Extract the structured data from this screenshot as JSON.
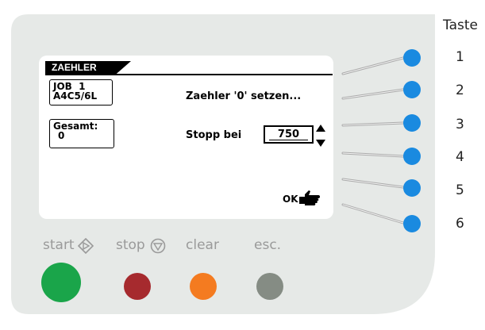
{
  "side_label": "Taste",
  "display": {
    "title": "ZAEHLER",
    "job_box": {
      "line1": "JOB  1",
      "line2": "A4C5/6L"
    },
    "total_box": {
      "label": "Gesamt:",
      "value": "0"
    },
    "reset_text": "Zaehler '0' setzen...",
    "stop_label": "Stopp bei",
    "stop_value": "750",
    "ok_label": "OK"
  },
  "softkeys": [
    {
      "number": "1"
    },
    {
      "number": "2"
    },
    {
      "number": "3"
    },
    {
      "number": "4"
    },
    {
      "number": "5"
    },
    {
      "number": "6"
    }
  ],
  "controls": {
    "start_label": "start",
    "stop_label": "stop",
    "clear_label": "clear",
    "esc_label": "esc."
  },
  "colors": {
    "panel": "#e6e9e7",
    "softkey": "#1a8ae0",
    "start": "#1aa54a",
    "stop": "#a62a2e",
    "clear": "#f47b20",
    "esc": "#858c84"
  },
  "icons": {
    "start": "diamond-play-icon",
    "stop": "circle-triangle-down-icon",
    "ok": "pointing-hand-icon"
  }
}
